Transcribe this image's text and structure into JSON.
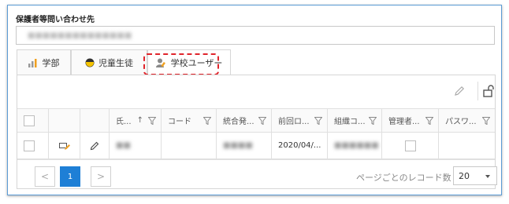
{
  "form": {
    "field_label": "保護者等問い合わせ先",
    "field_value": "■■■■■■■■■■■■■■"
  },
  "tabs": [
    {
      "label": "学部",
      "icon": "bar-chart-icon"
    },
    {
      "label": "児童生徒",
      "icon": "student-icon"
    },
    {
      "label": "学校ユーザー",
      "icon": "user-edit-icon",
      "active": true
    }
  ],
  "grid": {
    "columns": [
      "",
      "",
      "",
      "氏...",
      "コード",
      "統合発...",
      "前回ロ...",
      "組織コ...",
      "管理者...",
      "パスワ..."
    ],
    "sort_arrow": "↑",
    "rows": [
      {
        "name": "■■",
        "code": "",
        "integrated": "■■■■",
        "last_login": "2020/04/...",
        "org_code": "■■■■■■"
      }
    ]
  },
  "pager": {
    "prev": "<",
    "current": "1",
    "next": ">",
    "per_page_label": "ページごとのレコード数",
    "per_page_value": "20"
  },
  "colors": {
    "accent": "#1e7fd6",
    "frame_border": "#5b9bd5",
    "highlight": "#e0242b"
  }
}
